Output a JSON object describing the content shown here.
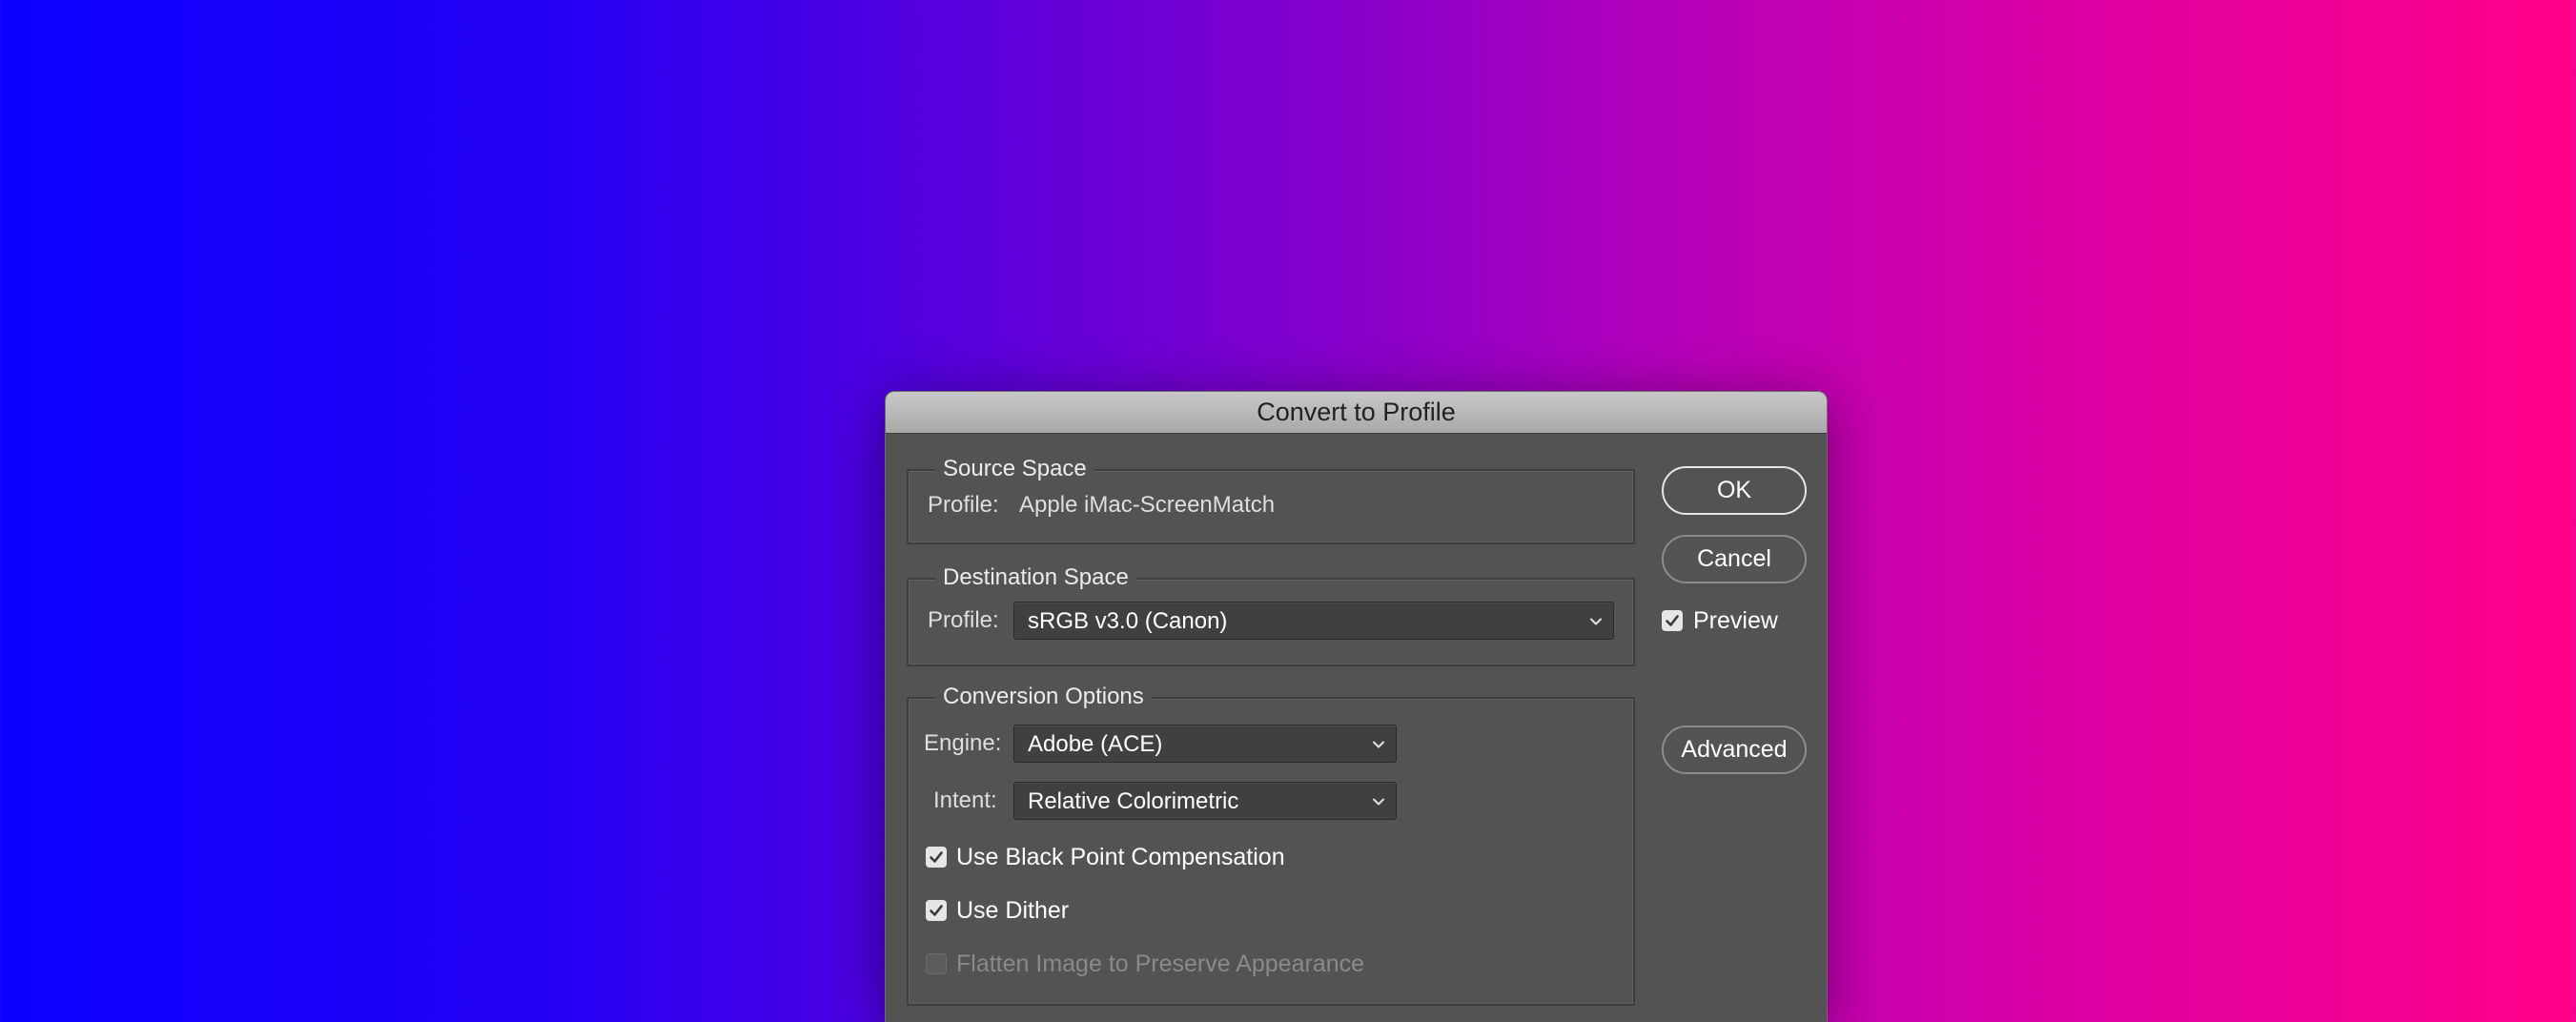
{
  "dialog": {
    "title": "Convert to Profile",
    "source_space": {
      "title": "Source Space",
      "profile_label": "Profile:",
      "profile_value": "Apple iMac-ScreenMatch"
    },
    "destination_space": {
      "title": "Destination Space",
      "profile_label": "Profile:",
      "profile_selected": "sRGB v3.0 (Canon)"
    },
    "conversion_options": {
      "title": "Conversion Options",
      "engine_label": "Engine:",
      "engine_selected": "Adobe (ACE)",
      "intent_label": "Intent:",
      "intent_selected": "Relative Colorimetric",
      "black_point_label": "Use Black Point Compensation",
      "black_point_checked": true,
      "dither_label": "Use Dither",
      "dither_checked": true,
      "flatten_label": "Flatten Image to Preserve Appearance",
      "flatten_checked": false,
      "flatten_enabled": false
    },
    "buttons": {
      "ok": "OK",
      "cancel": "Cancel",
      "advanced": "Advanced"
    },
    "preview": {
      "label": "Preview",
      "checked": true
    }
  },
  "colors": {
    "background_gradient_start": "#0a00ff",
    "background_gradient_end": "#ff0088",
    "dialog_bg": "#535353",
    "titlebar_bg": "#b8b8b8"
  }
}
